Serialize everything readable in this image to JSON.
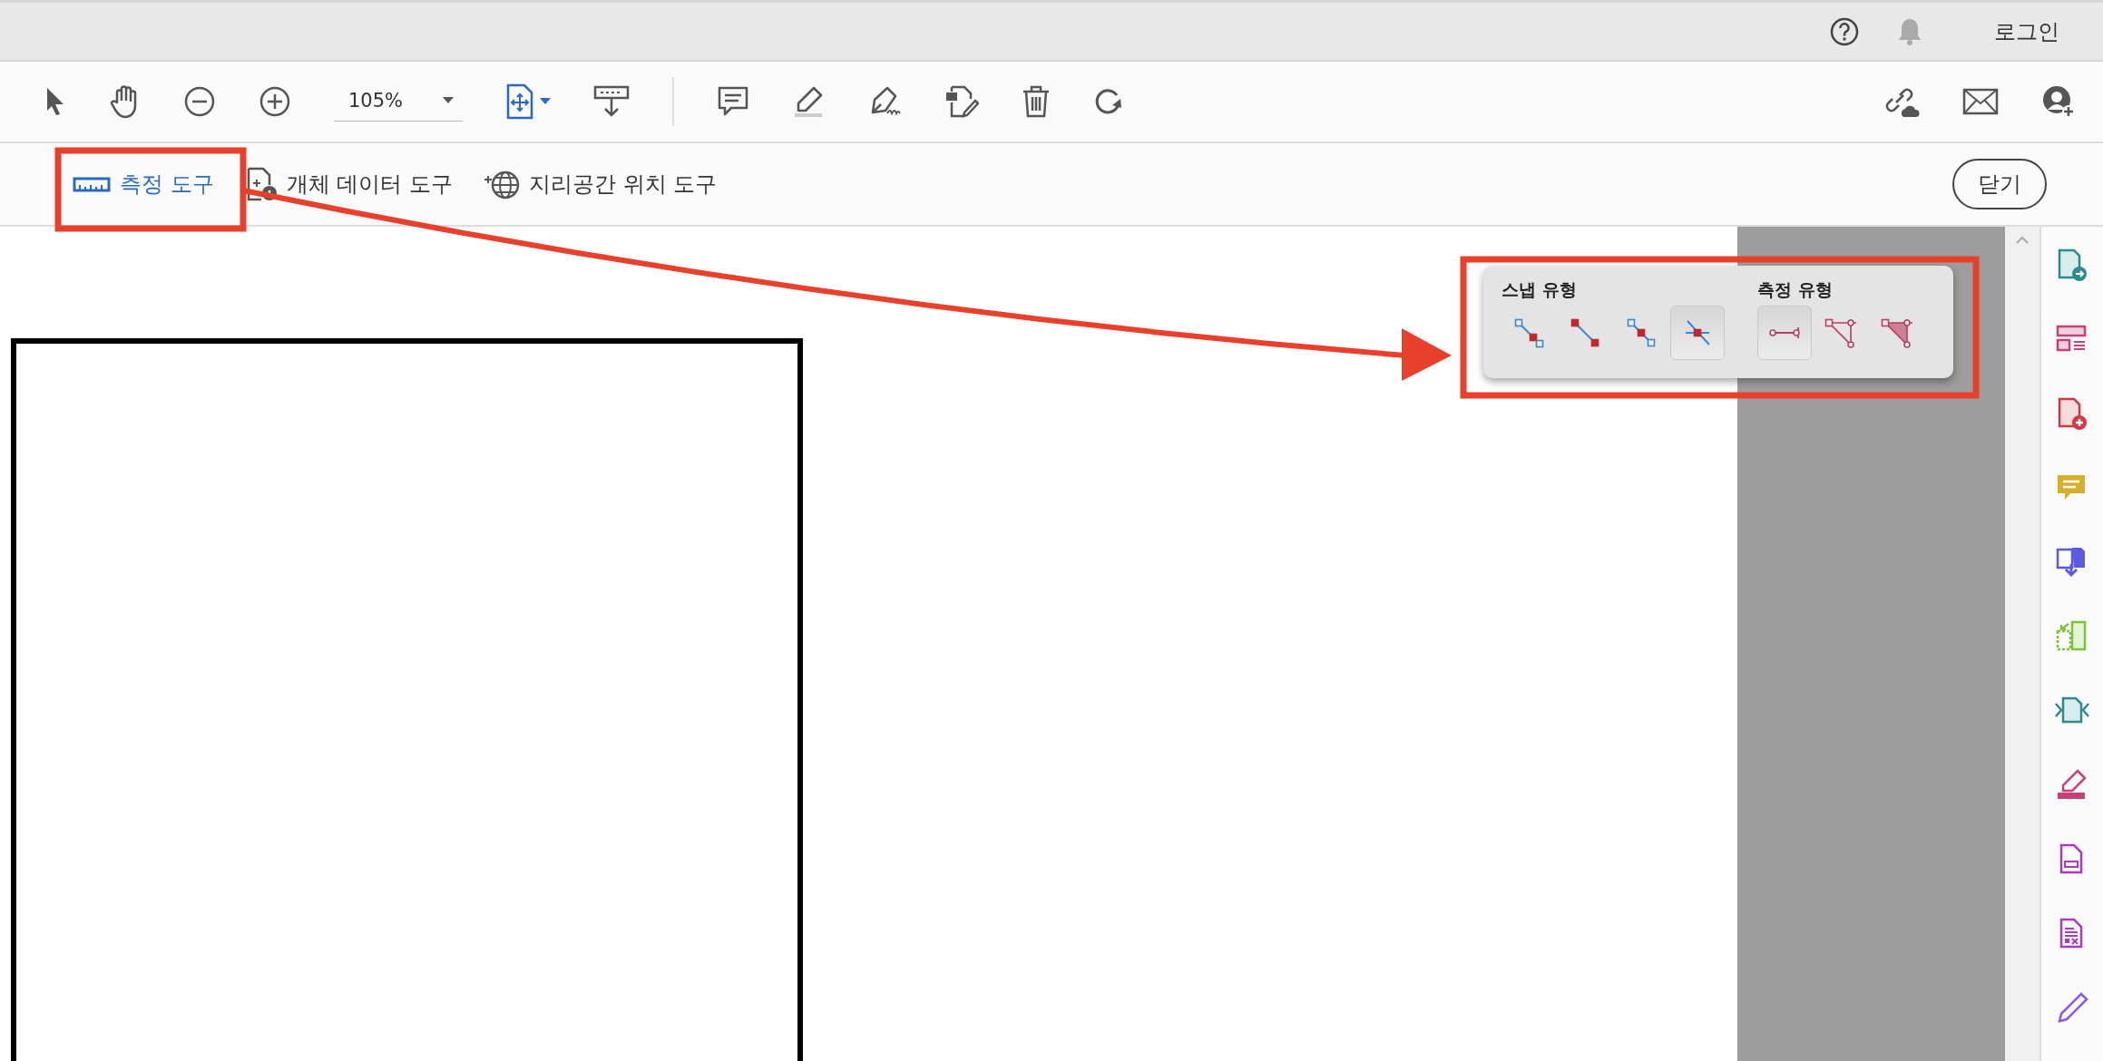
{
  "top_bar": {
    "login": "로그인"
  },
  "toolbar": {
    "zoom": {
      "value": "105%"
    }
  },
  "tool_tabs": [
    {
      "label": "측정 도구",
      "kind": "ruler",
      "selected": true
    },
    {
      "label": "개체 데이터 도구",
      "kind": "object",
      "selected": false
    },
    {
      "label": "지리공간 위치 도구",
      "kind": "globe",
      "selected": false
    }
  ],
  "close_button": "닫기",
  "snap_panel": {
    "snap_title": "스냅 유형",
    "snap_types": [
      {
        "kind": "endpoint",
        "selected": false
      },
      {
        "kind": "path",
        "selected": false
      },
      {
        "kind": "midpoint",
        "selected": false
      },
      {
        "kind": "intersection",
        "selected": true
      }
    ],
    "measure_title": "측정 유형",
    "measure_types": [
      {
        "kind": "distance",
        "selected": true
      },
      {
        "kind": "perimeter",
        "selected": false
      },
      {
        "kind": "area",
        "selected": false
      }
    ]
  },
  "sidebar": {
    "tools": [
      {
        "kind": "export",
        "color": "#2e8b8b"
      },
      {
        "kind": "layout",
        "color": "#c8407a"
      },
      {
        "kind": "create",
        "color": "#d2383f"
      },
      {
        "kind": "comment",
        "color": "#d6b02c"
      },
      {
        "kind": "combine",
        "color": "#5a5ae0"
      },
      {
        "kind": "organize",
        "color": "#7cc23a"
      },
      {
        "kind": "compress",
        "color": "#2e8b8b"
      },
      {
        "kind": "fill-sign",
        "color": "#c8407a"
      },
      {
        "kind": "form",
        "color": "#a83cc0"
      },
      {
        "kind": "redact",
        "color": "#a83cc0"
      },
      {
        "kind": "edit",
        "color": "#8c5ad8"
      }
    ]
  }
}
